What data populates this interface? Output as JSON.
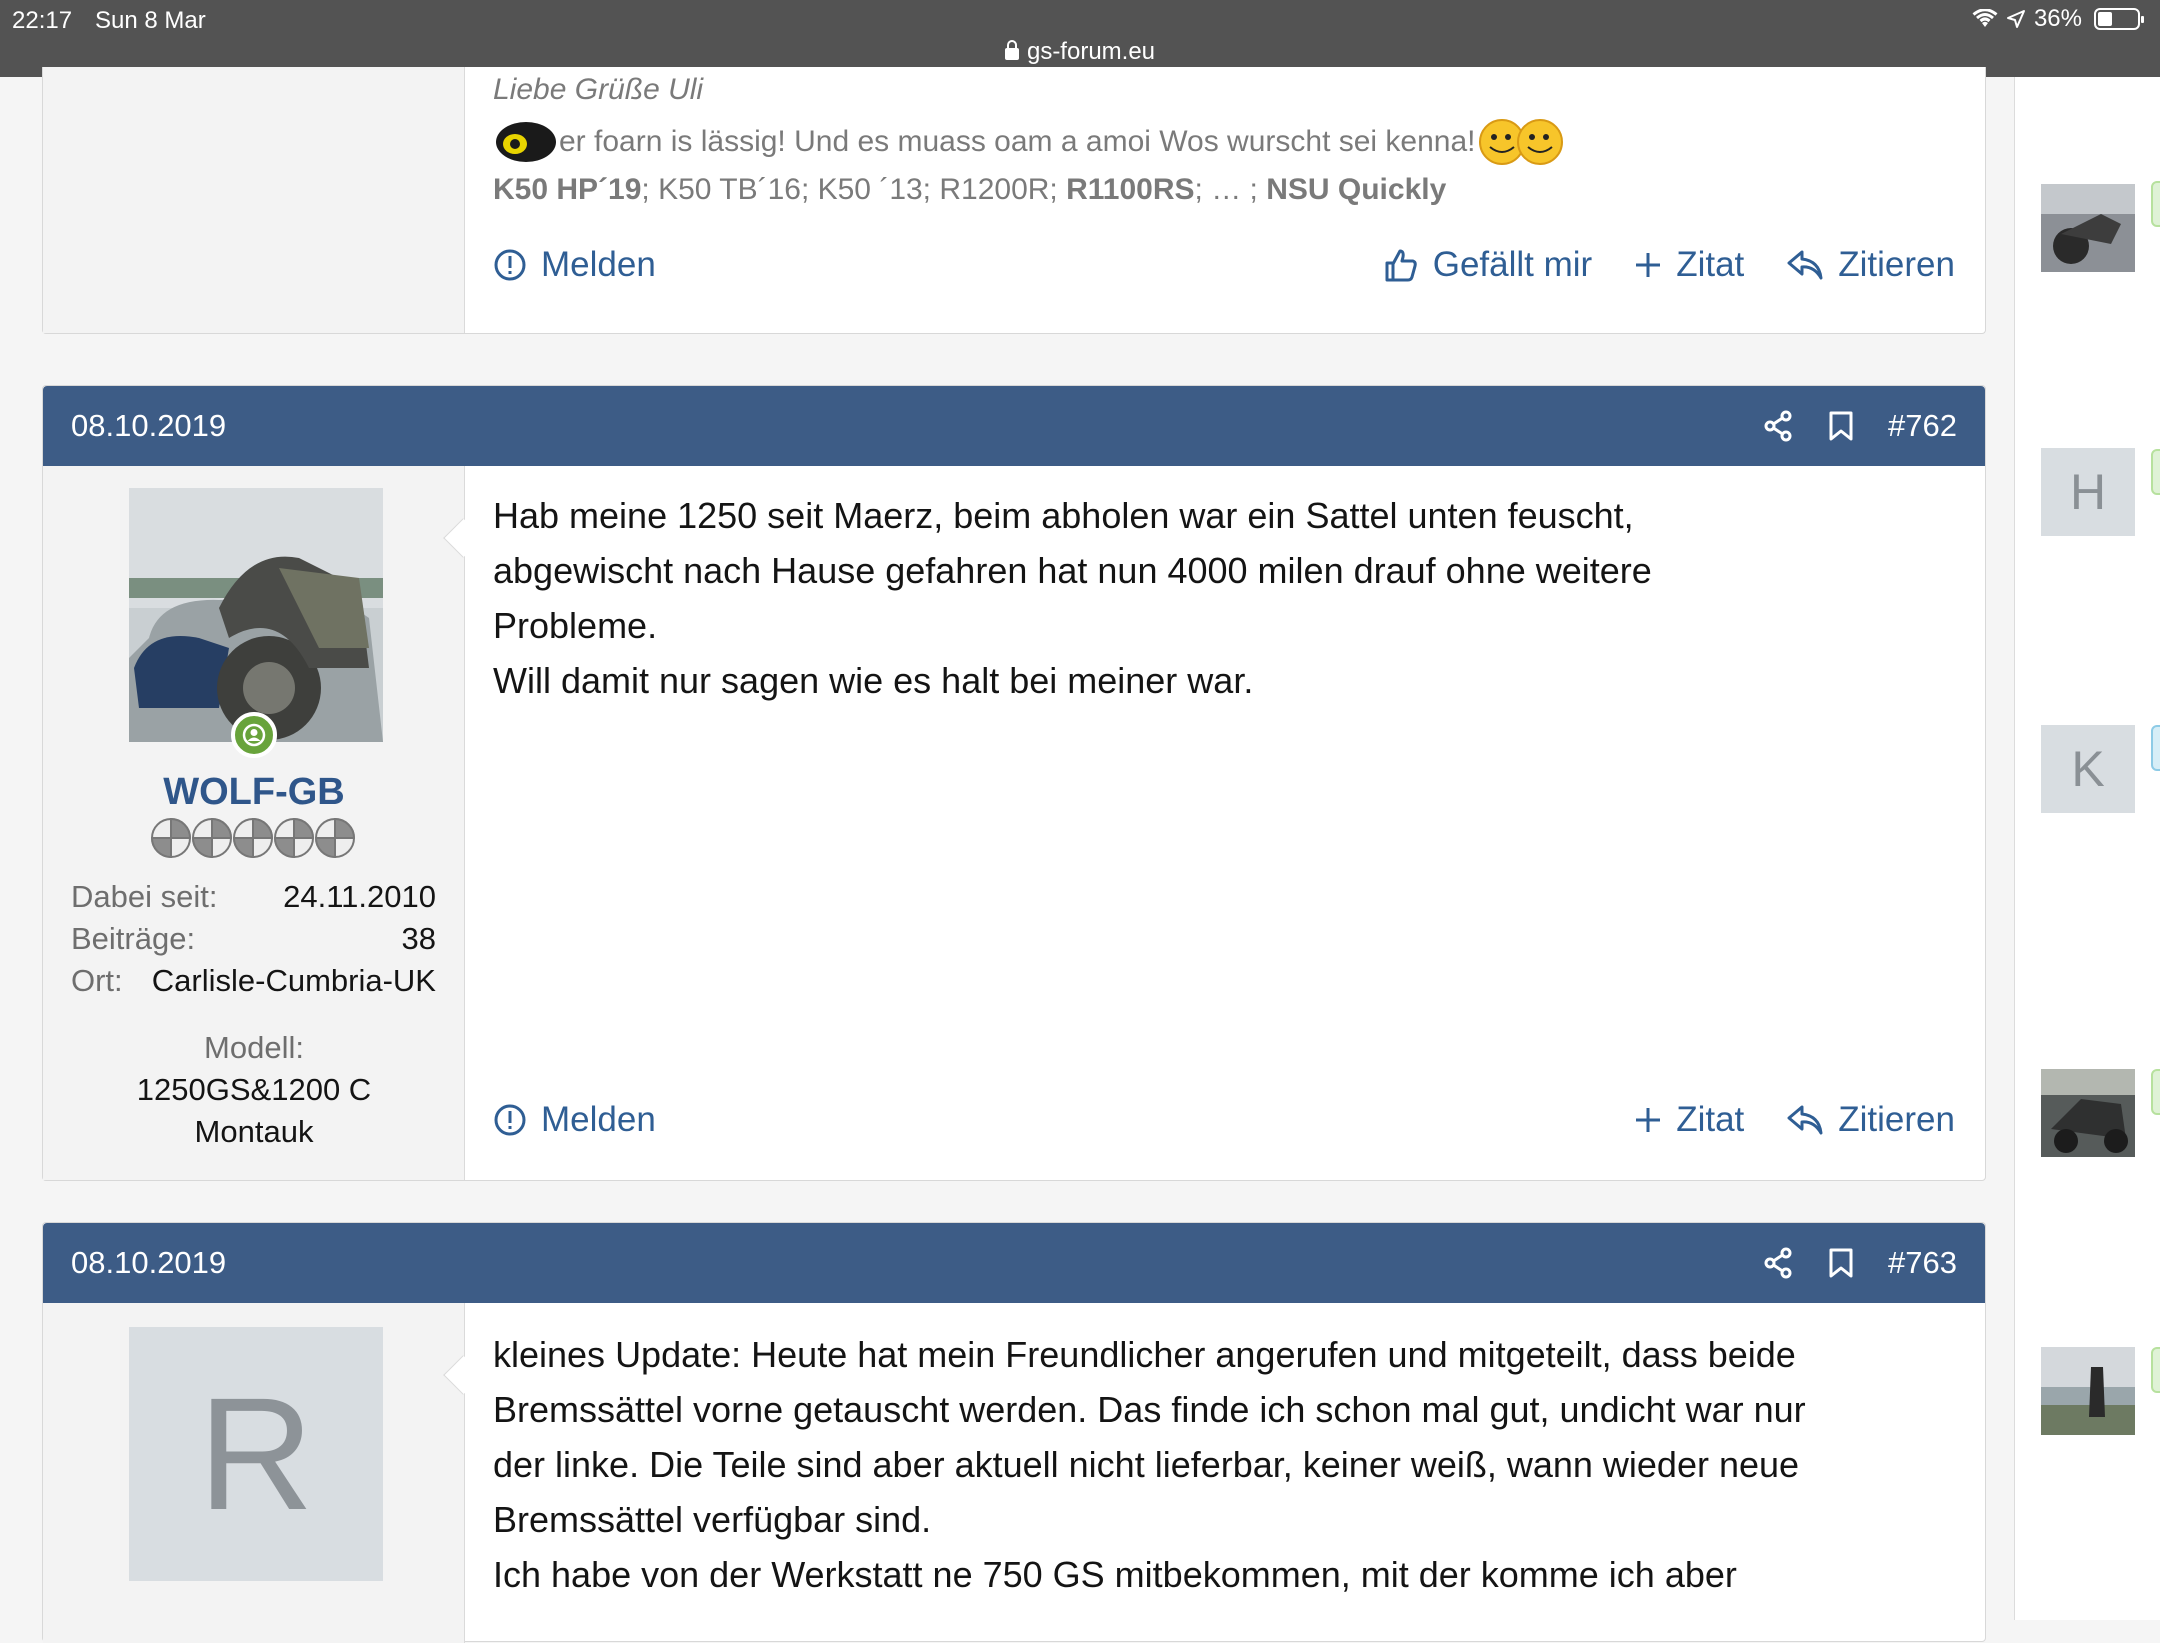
{
  "status_bar": {
    "time": "22:17",
    "date": "Sun 8 Mar",
    "battery": "36%",
    "url": "gs-forum.eu"
  },
  "prev_post": {
    "signature_name": "Liebe Grüße Uli",
    "signature_line": "er foarn is lässig! Und es muass oam a amoi Wos wurscht sei kenna!",
    "bikes": [
      {
        "text": "K50 HP´19",
        "bold": true
      },
      {
        "text": "; K50 TB´16; K50 ´13; R1200R; ",
        "bold": false
      },
      {
        "text": "R1100RS",
        "bold": true
      },
      {
        "text": "; … ; ",
        "bold": false
      },
      {
        "text": "NSU Quickly",
        "bold": true
      }
    ],
    "actions": {
      "report": "Melden",
      "like": "Gefällt mir",
      "quote_plus": "Zitat",
      "reply": "Zitieren"
    }
  },
  "post_762": {
    "date": "08.10.2019",
    "number": "#762",
    "user": {
      "name": "WOLF-GB",
      "stat_joined_label": "Dabei seit:",
      "stat_joined_value": "24.11.2010",
      "stat_posts_label": "Beiträge:",
      "stat_posts_value": "38",
      "stat_location_label": "Ort:",
      "stat_location_value": "Carlisle-Cumbria-UK",
      "model_label": "Modell:",
      "model_line1": "1250GS&1200 C",
      "model_line2": "Montauk"
    },
    "lines": [
      "Hab meine 1250 seit Maerz, beim abholen war ein Sattel unten feuscht,",
      "abgewischt nach Hause gefahren hat nun 4000 milen drauf ohne weitere",
      "Probleme.",
      "Will damit nur sagen wie es halt bei meiner war."
    ],
    "actions": {
      "report": "Melden",
      "quote_plus": "Zitat",
      "reply": "Zitieren"
    }
  },
  "post_763": {
    "date": "08.10.2019",
    "number": "#763",
    "avatar_letter": "R",
    "lines": [
      "kleines Update: Heute hat mein Freundlicher angerufen und mitgeteilt, dass beide",
      "Bremssättel vorne getauscht werden. Das finde ich schon mal gut, undicht war nur",
      "der linke. Die Teile sind aber aktuell nicht lieferbar, keiner weiß, wann wieder neue",
      "Bremssättel verfügbar sind.",
      "Ich habe von der Werkstatt ne 750 GS mitbekommen, mit der komme ich aber"
    ]
  },
  "sidebar": {
    "letter_h": "H",
    "letter_k": "K"
  },
  "colors": {
    "header_bg": "#3d5c86",
    "link": "#2f5e94",
    "username": "#2f568a",
    "online": "#68a33b"
  }
}
